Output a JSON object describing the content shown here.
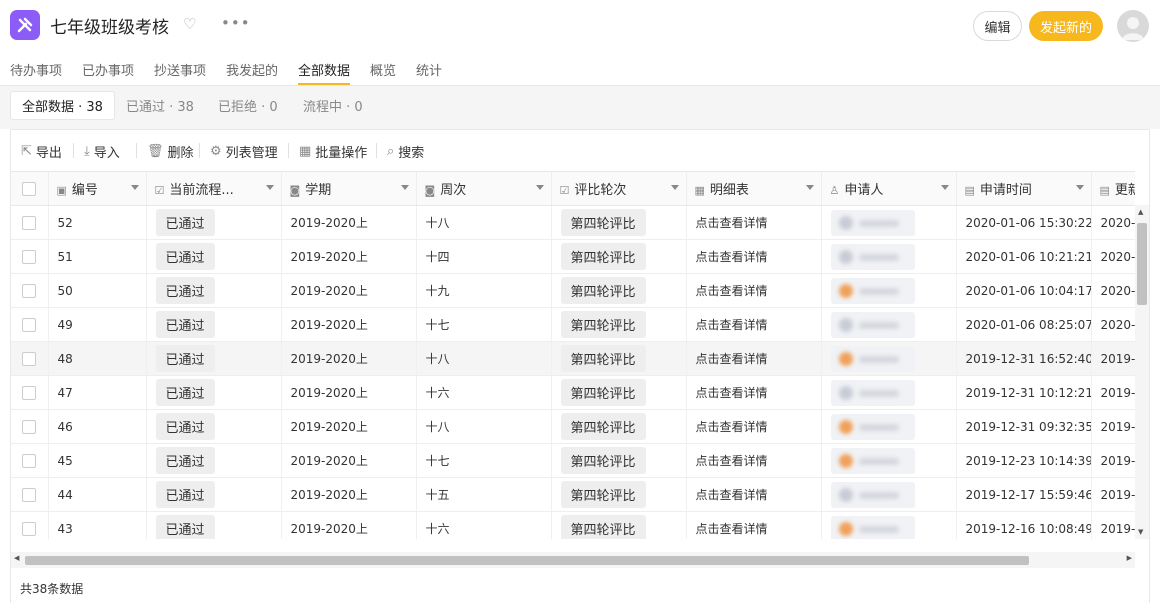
{
  "app": {
    "title": "七年级班级考核",
    "edit_label": "编辑",
    "new_label": "发起新的"
  },
  "nav": {
    "tabs": [
      "待办事项",
      "已办事项",
      "抄送事项",
      "我发起的",
      "全部数据",
      "概览",
      "统计"
    ],
    "active": "全部数据"
  },
  "subtabs": [
    "全部数据 · 38",
    "已通过 · 38",
    "已拒绝 · 0",
    "流程中 · 0"
  ],
  "toolbar": {
    "export": "导出",
    "import": "导入",
    "delete": "删除",
    "columns": "列表管理",
    "batch": "批量操作",
    "search": "搜索"
  },
  "columns": [
    "编号",
    "当前流程...",
    "学期",
    "周次",
    "评比轮次",
    "明细表",
    "申请人",
    "申请时间",
    "更新时"
  ],
  "rows": [
    {
      "id": "52",
      "status": "已通过",
      "term": "2019-2020上",
      "week": "十八",
      "round": "第四轮评比",
      "detail": "点击查看详情",
      "avatar": "gray",
      "time": "2020-01-06 15:30:22",
      "update": "2020-"
    },
    {
      "id": "51",
      "status": "已通过",
      "term": "2019-2020上",
      "week": "十四",
      "round": "第四轮评比",
      "detail": "点击查看详情",
      "avatar": "gray",
      "time": "2020-01-06 10:21:21",
      "update": "2020-"
    },
    {
      "id": "50",
      "status": "已通过",
      "term": "2019-2020上",
      "week": "十九",
      "round": "第四轮评比",
      "detail": "点击查看详情",
      "avatar": "orange",
      "time": "2020-01-06 10:04:17",
      "update": "2020-"
    },
    {
      "id": "49",
      "status": "已通过",
      "term": "2019-2020上",
      "week": "十七",
      "round": "第四轮评比",
      "detail": "点击查看详情",
      "avatar": "gray",
      "time": "2020-01-06 08:25:07",
      "update": "2020-"
    },
    {
      "id": "48",
      "status": "已通过",
      "term": "2019-2020上",
      "week": "十八",
      "round": "第四轮评比",
      "detail": "点击查看详情",
      "avatar": "orange",
      "time": "2019-12-31 16:52:40",
      "update": "2019-"
    },
    {
      "id": "47",
      "status": "已通过",
      "term": "2019-2020上",
      "week": "十六",
      "round": "第四轮评比",
      "detail": "点击查看详情",
      "avatar": "gray",
      "time": "2019-12-31 10:12:21",
      "update": "2019-"
    },
    {
      "id": "46",
      "status": "已通过",
      "term": "2019-2020上",
      "week": "十八",
      "round": "第四轮评比",
      "detail": "点击查看详情",
      "avatar": "orange",
      "time": "2019-12-31 09:32:35",
      "update": "2019-"
    },
    {
      "id": "45",
      "status": "已通过",
      "term": "2019-2020上",
      "week": "十七",
      "round": "第四轮评比",
      "detail": "点击查看详情",
      "avatar": "orange",
      "time": "2019-12-23 10:14:39",
      "update": "2019-"
    },
    {
      "id": "44",
      "status": "已通过",
      "term": "2019-2020上",
      "week": "十五",
      "round": "第四轮评比",
      "detail": "点击查看详情",
      "avatar": "gray",
      "time": "2019-12-17 15:59:46",
      "update": "2019-"
    },
    {
      "id": "43",
      "status": "已通过",
      "term": "2019-2020上",
      "week": "十六",
      "round": "第四轮评比",
      "detail": "点击查看详情",
      "avatar": "orange",
      "time": "2019-12-16 10:08:49",
      "update": "2019-"
    }
  ],
  "footer": "共38条数据",
  "colors": {
    "accent": "#f7b81e",
    "app_icon": "#8b5cf6"
  }
}
